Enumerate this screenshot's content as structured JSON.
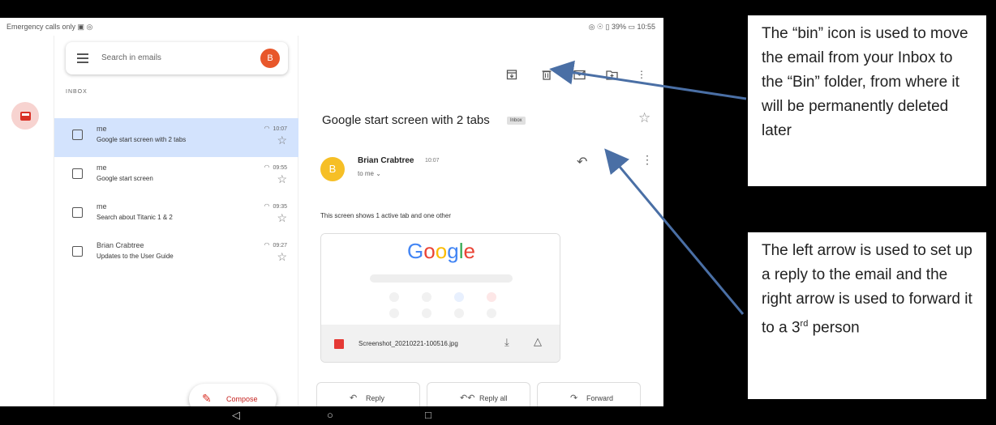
{
  "status": {
    "left": "Emergency calls only ▣ ◎",
    "right": "◎ ☉ ▯ 39% ▭ 10:55"
  },
  "search": {
    "placeholder": "Search in emails",
    "avatar": "B"
  },
  "list": {
    "section_label": "INBOX",
    "items": [
      {
        "sender": "me",
        "subject": "Google start screen with 2 tabs",
        "time": "10:07",
        "selected": true
      },
      {
        "sender": "me",
        "subject": "Google start screen",
        "time": "09:55",
        "selected": false
      },
      {
        "sender": "me",
        "subject": "Search about Titanic 1 & 2",
        "time": "09:35",
        "selected": false
      },
      {
        "sender": "Brian Crabtree",
        "subject": "Updates to the User Guide",
        "time": "09:27",
        "selected": false
      }
    ]
  },
  "compose": {
    "label": "Compose"
  },
  "toolbar": {
    "icons": [
      "archive-icon",
      "bin-icon",
      "mark-unread-icon",
      "move-to-icon",
      "more-vert-icon"
    ]
  },
  "message": {
    "subject": "Google start screen with 2 tabs",
    "badge": "Inbox",
    "sender_avatar": "B",
    "sender_name": "Brian Crabtree",
    "time": "10:07",
    "to": "to me ⌄",
    "body": "This screen shows 1 active tab and one other",
    "attachment": {
      "preview_logo": "Google",
      "filename": "Screenshot_20210221-100516.jpg"
    }
  },
  "actions": {
    "reply": "Reply",
    "reply_all": "Reply all",
    "forward": "Forward"
  },
  "callouts": {
    "bin": "The “bin” icon is used to move the email from your Inbox to the “Bin” folder, from where it will be permanently deleted later",
    "arrows_part1": "The left arrow is used to set up a reply to the email and the right arrow is used to forward it to a 3",
    "arrows_sup": "rd",
    "arrows_part2": " person"
  },
  "colors": {
    "accent_red": "#d93025",
    "selected_row": "#d3e3fd",
    "arrow": "#4a6fa5"
  }
}
